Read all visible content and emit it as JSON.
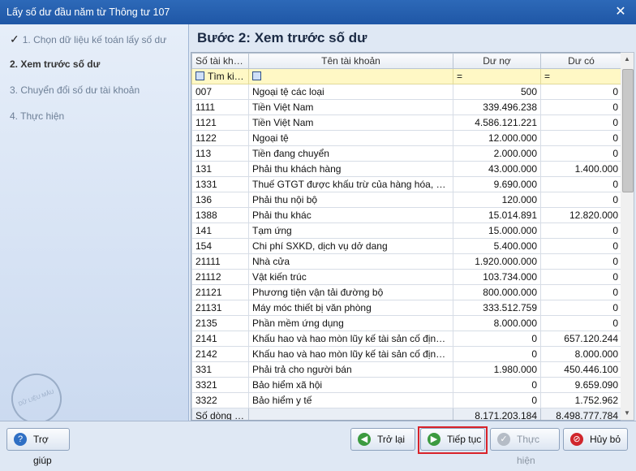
{
  "window": {
    "title": "Lấy số dư đầu năm từ Thông tư 107",
    "close_glyph": "✕"
  },
  "steps": [
    {
      "label": "1. Chọn dữ liệu kế toán lấy số dư",
      "done": true
    },
    {
      "label": "2. Xem trước số dư",
      "active": true
    },
    {
      "label": "3. Chuyển đổi số dư tài khoản"
    },
    {
      "label": "4. Thực hiện"
    }
  ],
  "watermark": "DỮ LIỆU MẪU",
  "heading": "Bước 2: Xem trước số dư",
  "table": {
    "columns": [
      "Số tài khoản",
      "Tên tài khoản",
      "Dư nợ",
      "Dư có"
    ],
    "filter": {
      "search_label": "Tìm kiếm",
      "eq1": "=",
      "eq2": "="
    },
    "rows": [
      [
        "007",
        "Ngoại tệ các loại",
        "500",
        "0"
      ],
      [
        "1111",
        "Tiền Việt Nam",
        "339.496.238",
        "0"
      ],
      [
        "1121",
        "Tiền Việt Nam",
        "4.586.121.221",
        "0"
      ],
      [
        "1122",
        "Ngoại tệ",
        "12.000.000",
        "0"
      ],
      [
        "113",
        "Tiền đang chuyển",
        "2.000.000",
        "0"
      ],
      [
        "131",
        "Phải thu khách hàng",
        "43.000.000",
        "1.400.000"
      ],
      [
        "1331",
        "Thuế GTGT được khấu trừ của hàng hóa, dịch vụ",
        "9.690.000",
        "0"
      ],
      [
        "136",
        "Phải thu nội bộ",
        "120.000",
        "0"
      ],
      [
        "1388",
        "Phải thu khác",
        "15.014.891",
        "12.820.000"
      ],
      [
        "141",
        "Tạm ứng",
        "15.000.000",
        "0"
      ],
      [
        "154",
        "Chi phí SXKD, dịch vụ dở dang",
        "5.400.000",
        "0"
      ],
      [
        "21111",
        "Nhà cửa",
        "1.920.000.000",
        "0"
      ],
      [
        "21112",
        "Vật kiến trúc",
        "103.734.000",
        "0"
      ],
      [
        "21121",
        "Phương tiện vận tải đường bộ",
        "800.000.000",
        "0"
      ],
      [
        "21131",
        "Máy móc thiết bị văn phòng",
        "333.512.759",
        "0"
      ],
      [
        "2135",
        "Phần mềm ứng dụng",
        "8.000.000",
        "0"
      ],
      [
        "2141",
        "Khấu hao và hao mòn lũy kế tài sản cố định hữ...",
        "0",
        "657.120.244"
      ],
      [
        "2142",
        "Khấu hao và hao mòn lũy kế tài sản cố định vô...",
        "0",
        "8.000.000"
      ],
      [
        "331",
        "Phải trả cho người bán",
        "1.980.000",
        "450.446.100"
      ],
      [
        "3321",
        "Bảo hiểm xã hội",
        "0",
        "9.659.090"
      ],
      [
        "3322",
        "Bảo hiểm y tế",
        "0",
        "1.752.962"
      ]
    ],
    "footer": {
      "label": "Số dòng =...",
      "debit_total": "8.171.203.184",
      "credit_total": "8.498.777.784"
    }
  },
  "buttons": {
    "help": "Trợ giúp",
    "back": "Trở lại",
    "next": "Tiếp tục",
    "run": "Thực hiện",
    "cancel": "Hủy bỏ"
  }
}
